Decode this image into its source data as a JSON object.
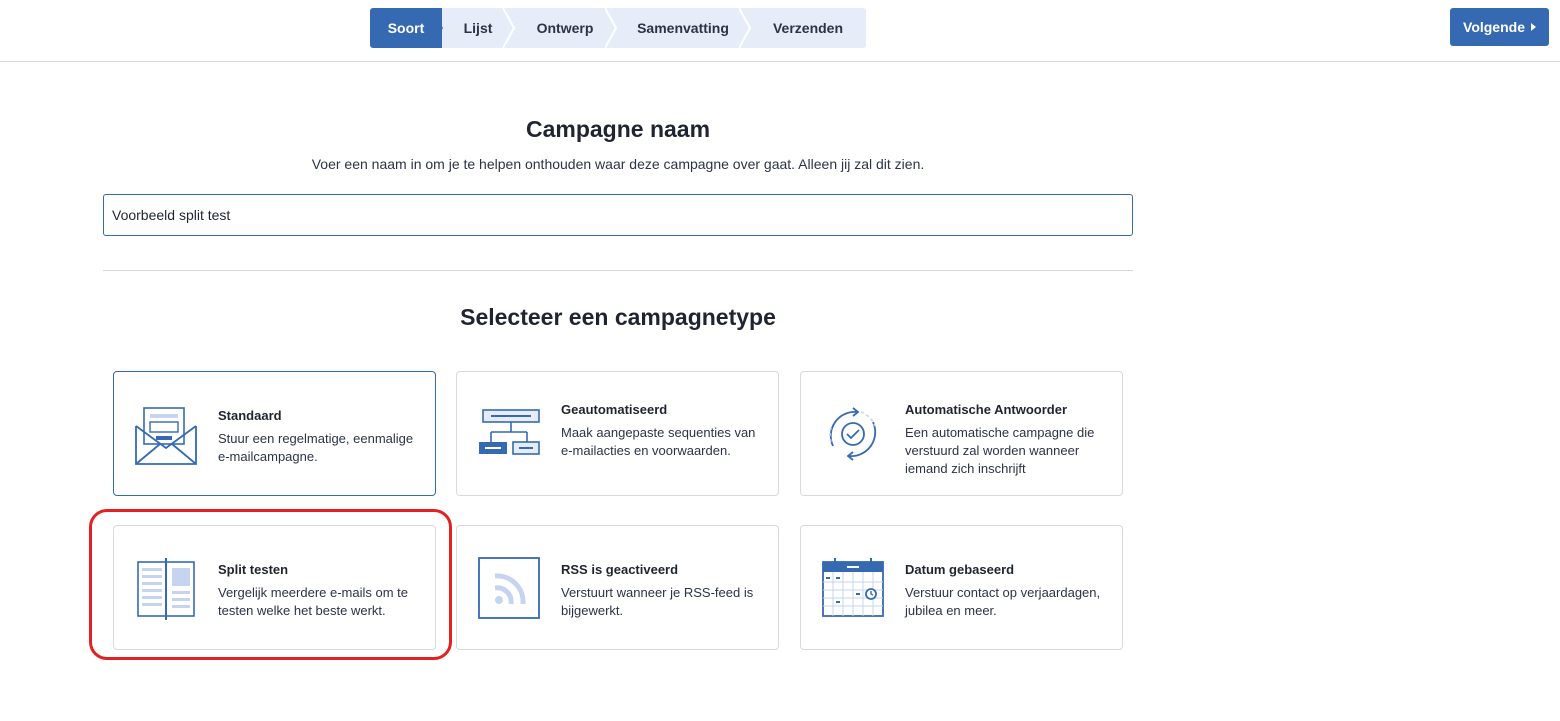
{
  "wizard": {
    "steps": [
      "Soort",
      "Lijst",
      "Ontwerp",
      "Samenvatting",
      "Verzenden"
    ],
    "active_step": "Soort",
    "next_label": "Volgende"
  },
  "campaign_name": {
    "title": "Campagne naam",
    "subtitle": "Voer een naam in om je te helpen onthouden waar deze campagne over gaat. Alleen jij zal dit zien.",
    "value": "Voorbeeld split test"
  },
  "campaign_type": {
    "title": "Selecteer een campagnetype",
    "cards": [
      {
        "title": "Standaard",
        "desc": "Stuur een regelmatige, eenmalige e-mailcampagne.",
        "icon": "envelope-icon"
      },
      {
        "title": "Geautomatiseerd",
        "desc": "Maak aangepaste sequenties van e-mailacties en voorwaarden.",
        "icon": "automation-flow-icon"
      },
      {
        "title": "Automatische Antwoorder",
        "desc": "Een automatische campagne die verstuurd zal worden wanneer iemand zich inschrijft",
        "icon": "autoresponder-cycle-icon"
      },
      {
        "title": "Split testen",
        "desc": "Vergelijk meerdere e-mails om te testen welke het beste werkt.",
        "icon": "split-test-icon"
      },
      {
        "title": "RSS is geactiveerd",
        "desc": "Verstuurt wanneer je RSS-feed is bijgewerkt.",
        "icon": "rss-icon"
      },
      {
        "title": "Datum gebaseerd",
        "desc": "Verstuur contact op verjaardagen, jubilea en meer.",
        "icon": "calendar-icon"
      }
    ]
  },
  "colors": {
    "accent": "#356ab3",
    "step_inactive": "#e6edf8",
    "highlight": "#e52020"
  }
}
